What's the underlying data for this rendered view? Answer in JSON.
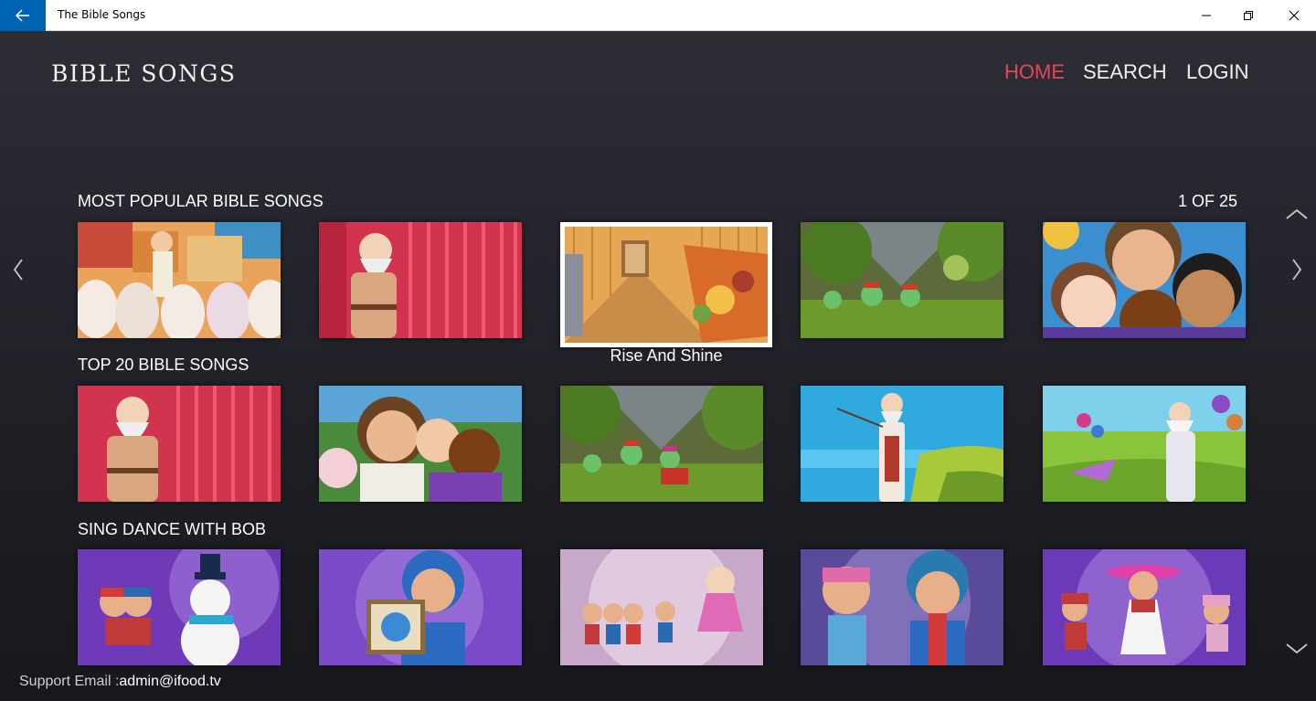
{
  "window": {
    "title": "The Bible Songs",
    "back_icon": "arrow-left-icon",
    "controls": [
      "minimize-icon",
      "restore-icon",
      "close-icon"
    ]
  },
  "header": {
    "logo": "BIBLE SONGS",
    "nav": {
      "home": "HOME",
      "search": "SEARCH",
      "login": "LOGIN"
    },
    "active_color": "#e8445b"
  },
  "sections": [
    {
      "title": "MOST POPULAR BIBLE SONGS",
      "page_indicator": "1 OF 25",
      "items": [
        {
          "scene": "crowd-town"
        },
        {
          "scene": "elder-red-curtain"
        },
        {
          "scene": "harvest-barn",
          "caption": "Rise And Shine",
          "selected": true
        },
        {
          "scene": "forest-band"
        },
        {
          "scene": "family-closeup"
        }
      ]
    },
    {
      "title": "TOP 20 BIBLE SONGS",
      "items": [
        {
          "scene": "elder-red-curtain"
        },
        {
          "scene": "jesus-children"
        },
        {
          "scene": "forest-band"
        },
        {
          "scene": "sea-prophet"
        },
        {
          "scene": "meadow-prophet"
        }
      ]
    },
    {
      "title": "SING DANCE WITH BOB",
      "items": [
        {
          "scene": "bob-snowman"
        },
        {
          "scene": "bob-painting"
        },
        {
          "scene": "bob-fairy"
        },
        {
          "scene": "bob-winter"
        },
        {
          "scene": "bob-pink-hat"
        }
      ]
    }
  ],
  "footer": {
    "support_label": "Support Email :",
    "support_email": "admin@ifood.tv"
  },
  "colors": {
    "accent": "#e8445b",
    "back_button": "#0063b1",
    "background_top": "#2c2d35",
    "background_bottom": "#17181c"
  }
}
